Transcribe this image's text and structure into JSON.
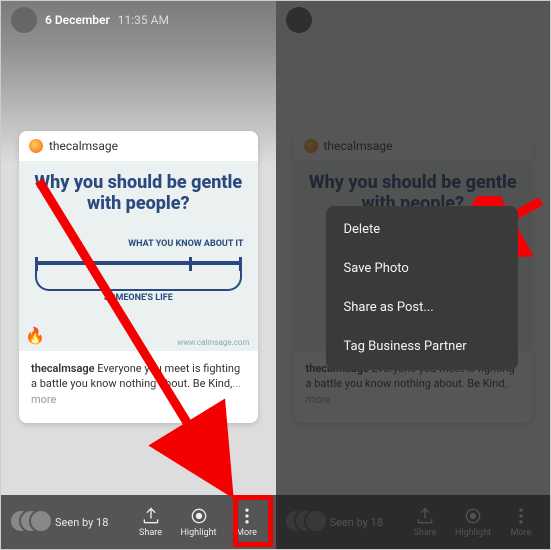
{
  "header": {
    "date": "6 December",
    "time": "11:35 AM"
  },
  "card": {
    "username": "thecalmsage",
    "headline": "Why you should be gentle with people?",
    "annot_know": "WHAT YOU KNOW ABOUT IT",
    "annot_life": "SOMEONE'S LIFE",
    "watermark": "www.calmsage.com"
  },
  "caption": {
    "user": "thecalmsage",
    "text": " Everyone you meet is fighting a battle you know nothing about. Be Kind,",
    "more": "... more"
  },
  "bottom": {
    "seen_label": "Seen by 18",
    "share": "Share",
    "highlight": "Highlight",
    "more": "More"
  },
  "menu": {
    "delete": "Delete",
    "save": "Save Photo",
    "share_post": "Share as Post...",
    "tag_partner": "Tag Business Partner"
  },
  "colors": {
    "highlight": "#f40000",
    "accent": "#2a4a7f"
  }
}
